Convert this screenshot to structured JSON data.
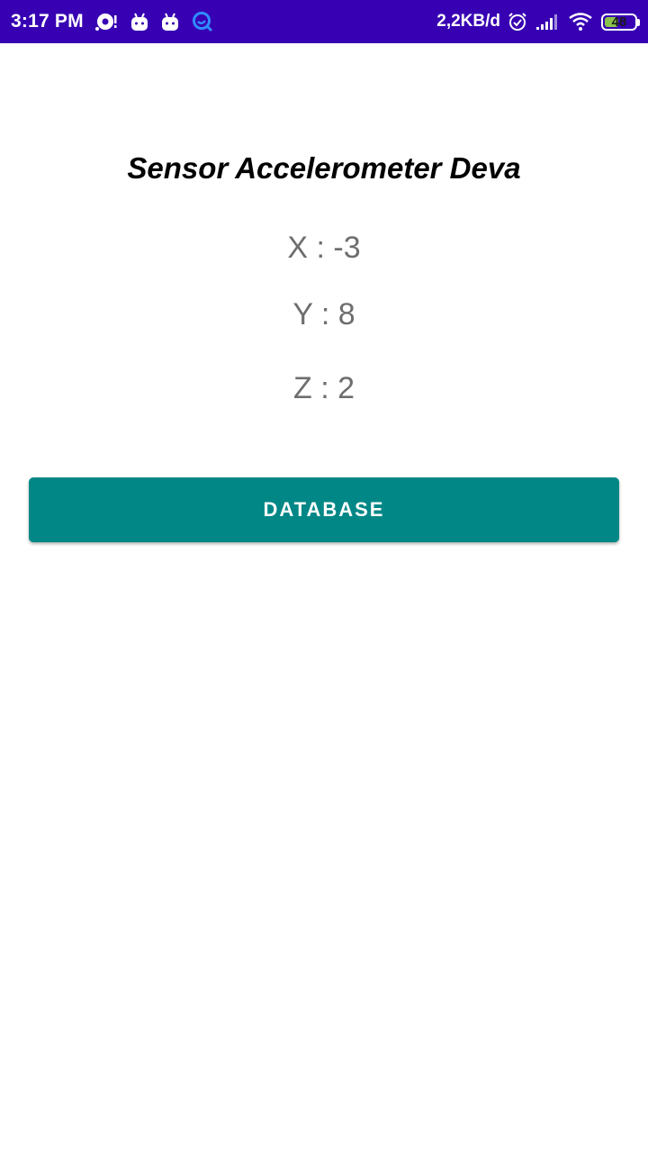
{
  "status_bar": {
    "time": "3:17 PM",
    "network_speed": "2,2KB/d",
    "battery_level": "48",
    "battery_percent": 48,
    "background_color": "#3700b3",
    "notification_icons": [
      "sync-icon",
      "android-icon",
      "android-icon",
      "q-app-icon"
    ],
    "system_icons": [
      "alarm-icon",
      "signal-icon",
      "wifi-icon",
      "battery-icon"
    ]
  },
  "main": {
    "title": "Sensor Accelerometer Deva",
    "readings": {
      "x": "X : -3",
      "y": "Y : 8",
      "z": "Z : 2"
    },
    "database_button_label": "DATABASE",
    "button_color": "#018786"
  }
}
